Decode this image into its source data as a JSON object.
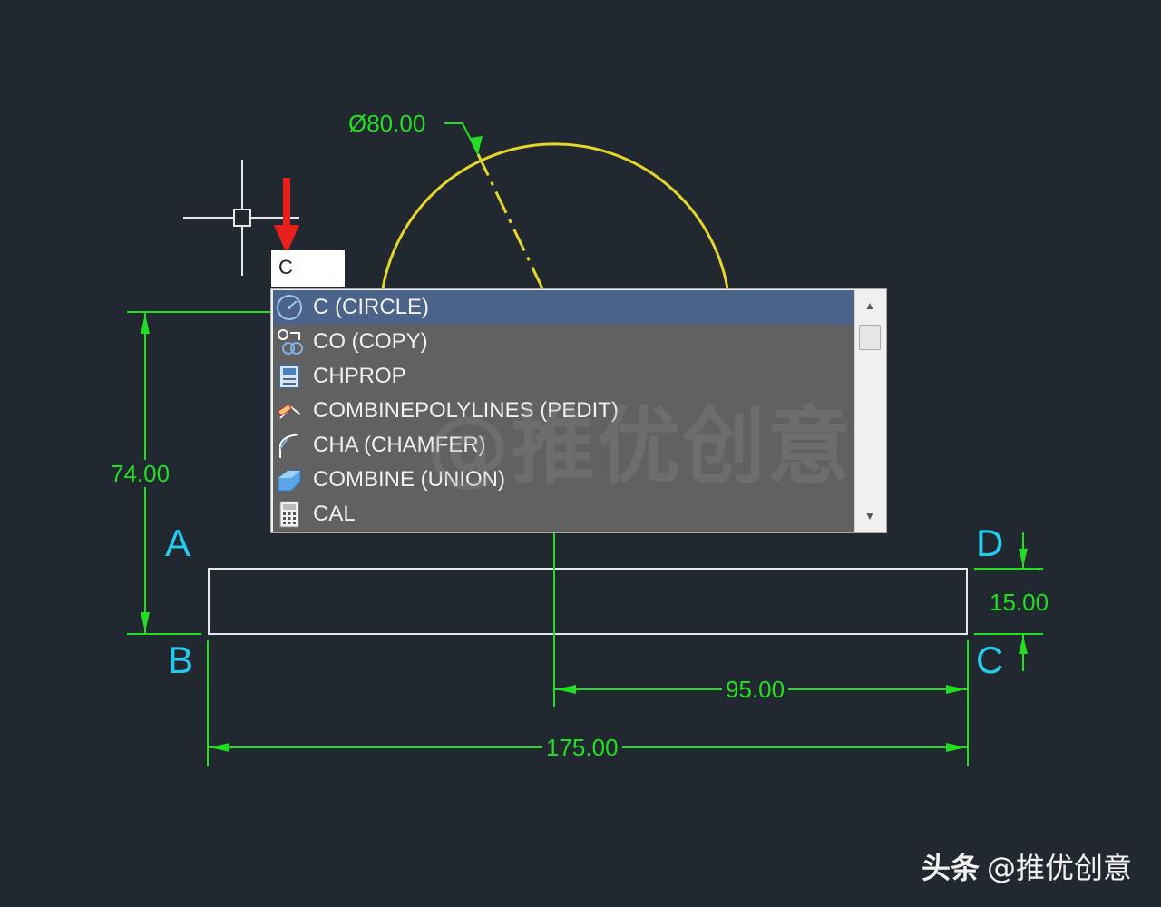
{
  "drawing": {
    "diameter_label": "Ø80.00",
    "dim_vertical": "74.00",
    "dim_right": "15.00",
    "dim_partial": "95.00",
    "dim_total": "175.00",
    "points": {
      "a": "A",
      "b": "B",
      "c": "C",
      "d": "D"
    },
    "colors": {
      "dimension": "#22dd22",
      "circle": "#e5d62a",
      "points": "#22ccee",
      "outline": "#e8e8e8",
      "arrow": "#e8201c"
    }
  },
  "command": {
    "input_value": "C",
    "suggestions": [
      {
        "label": "C (CIRCLE)",
        "icon": "circle-icon",
        "selected": true
      },
      {
        "label": "CO (COPY)",
        "icon": "copy-icon",
        "selected": false
      },
      {
        "label": "CHPROP",
        "icon": "properties-icon",
        "selected": false
      },
      {
        "label": "COMBINEPOLYLINES (PEDIT)",
        "icon": "polyline-edit-icon",
        "selected": false
      },
      {
        "label": "CHA (CHAMFER)",
        "icon": "chamfer-icon",
        "selected": false
      },
      {
        "label": "COMBINE (UNION)",
        "icon": "union-icon",
        "selected": false
      },
      {
        "label": "CAL",
        "icon": "calculator-icon",
        "selected": false
      }
    ]
  },
  "watermark": "@推优创意",
  "footer": {
    "platform": "头条",
    "account": "@推优创意"
  }
}
